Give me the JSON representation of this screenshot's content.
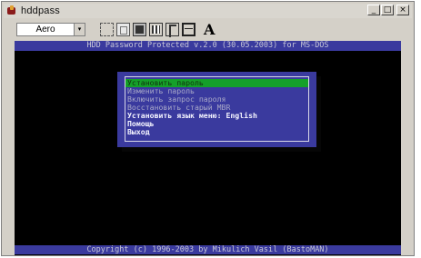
{
  "window": {
    "title": "hddpass",
    "controls": {
      "minimize": "_",
      "maximize": "□",
      "close": "×"
    }
  },
  "toolbar": {
    "font_select": {
      "value": "Aero",
      "arrow": "▾"
    },
    "font_button_label": "A"
  },
  "screen": {
    "header": "HDD Password Protected v.2.0 (30.05.2003) for MS-DOS",
    "footer": "Copyright (c) 1996-2003 by Mikulich Vasil (BastoMAN)"
  },
  "menu": {
    "items": [
      {
        "label": "Установить пароль",
        "selected": true,
        "bright": false
      },
      {
        "label": "Изменить пароль",
        "selected": false,
        "bright": false
      },
      {
        "label": "Включить запрос пароля",
        "selected": false,
        "bright": false
      },
      {
        "label": "Восстановить старый MBR",
        "selected": false,
        "bright": false
      },
      {
        "label": "Установить язык меню: English",
        "selected": false,
        "bright": true
      },
      {
        "label": "Помощь",
        "selected": false,
        "bright": true
      },
      {
        "label": "Выход",
        "selected": false,
        "bright": true
      }
    ]
  },
  "colors": {
    "dos_blue": "#3a3a9e",
    "dos_black": "#000000",
    "selection_green": "#15a02a",
    "window_gray": "#d4d0c8"
  }
}
